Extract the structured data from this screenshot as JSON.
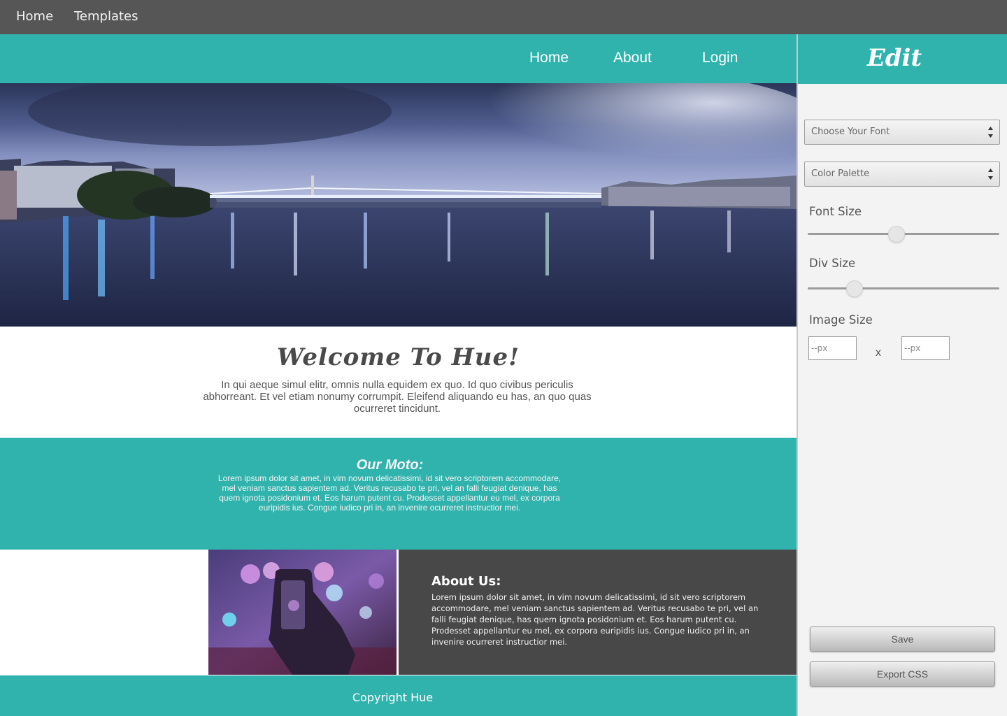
{
  "app_nav": {
    "home": "Home",
    "templates": "Templates"
  },
  "site": {
    "nav": {
      "home": "Home",
      "about": "About",
      "login": "Login"
    },
    "welcome": {
      "title": "Welcome To Hue!",
      "text": "In qui aeque simul elitr, omnis nulla equidem ex quo. Id quo civibus periculis abhorreant. Et vel etiam nonumy corrumpit. Eleifend aliquando eu has, an quo quas ocurreret tincidunt."
    },
    "moto": {
      "title": "Our Moto:",
      "text": "Lorem ipsum dolor sit amet, in vim novum delicatissimi, id sit vero scriptorem accommodare, mel veniam sanctus sapientem ad. Veritus recusabo te pri, vel an falli feugiat denique, has quem ignota posidonium et. Eos harum putent cu. Prodesset appellantur eu mel, ex corpora euripidis ius. Congue iudico pri in, an invenire ocurreret instructior mei."
    },
    "about": {
      "title": "About Us:",
      "text": "Lorem ipsum dolor sit amet, in vim novum delicatissimi, id sit vero scriptorem accommodare, mel veniam sanctus sapientem ad. Veritus recusabo te pri, vel an falli feugiat denique, has quem ignota posidonium et. Eos harum putent cu. Prodesset appellantur eu mel, ex corpora euripidis ius. Congue iudico pri in, an invenire ocurreret instructior mei."
    },
    "footer": "Copyright Hue"
  },
  "panel": {
    "title": "Edit",
    "font_select": "Choose Your Font",
    "palette_select": "Color Palette",
    "font_size_label": "Font Size",
    "font_size_value": 0.46,
    "div_size_label": "Div Size",
    "div_size_value": 0.22,
    "image_size_label": "Image Size",
    "width_placeholder": "--px",
    "height_placeholder": "--px",
    "times": "x",
    "save": "Save",
    "export": "Export CSS"
  },
  "colors": {
    "teal": "#31b3ad",
    "dark_gray": "#484848",
    "top_bar": "#565656",
    "panel_bg": "#f3f3f3"
  }
}
